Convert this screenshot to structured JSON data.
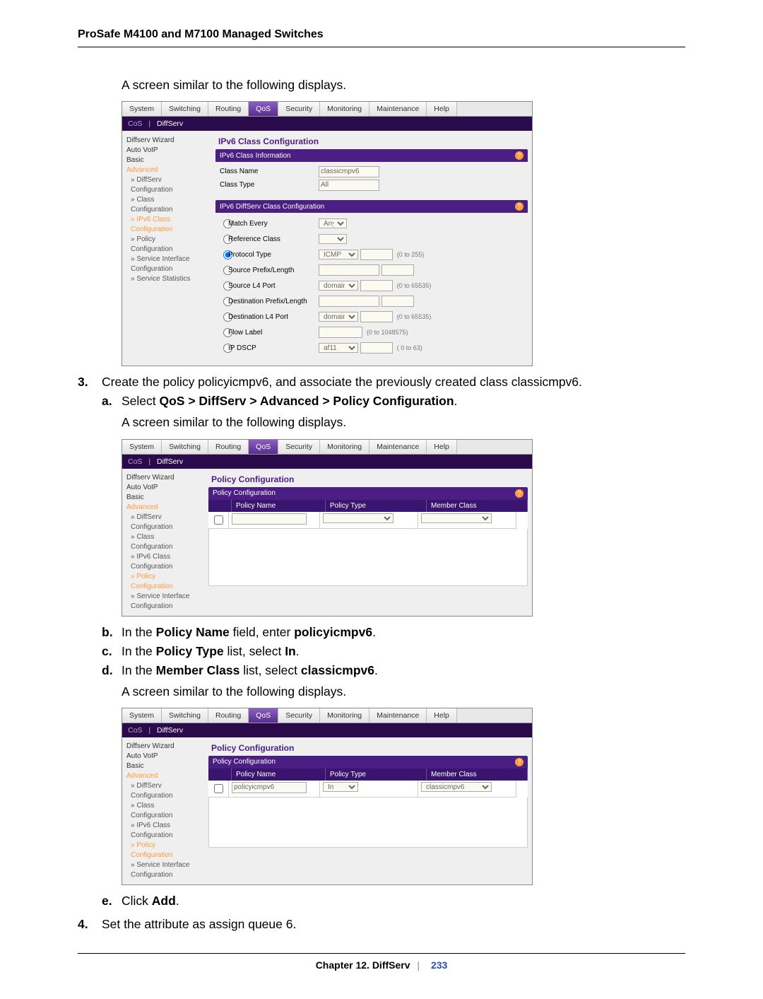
{
  "doc": {
    "header": "ProSafe M4100 and M7100 Managed Switches",
    "chapter": "Chapter 12.  DiffServ",
    "page": "233"
  },
  "text": {
    "similar1": "A screen similar to the following displays.",
    "step3": "Create the policy policyicmpv6, and associate the previously created class classicmpv6.",
    "step3a_pre": "Select ",
    "step3a_bold": "QoS > DiffServ > Advanced > Policy Configuration",
    "similar2": "A screen similar to the following displays.",
    "step3b_pre": "In the ",
    "step3b_b1": "Policy Name",
    "step3b_mid": " field, enter ",
    "step3b_b2": "policyicmpv6",
    "step3c_pre": "In the ",
    "step3c_b1": "Policy Type",
    "step3c_mid": " list, select ",
    "step3c_b2": "In",
    "step3d_pre": "In the ",
    "step3d_b1": "Member Class",
    "step3d_mid": " list, select ",
    "step3d_b2": "classicmpv6",
    "similar3": "A screen similar to the following displays.",
    "step3e_pre": "Click ",
    "step3e_b": "Add",
    "step4": "Set the attribute as assign queue 6."
  },
  "ui": {
    "tabs": [
      "System",
      "Switching",
      "Routing",
      "QoS",
      "Security",
      "Monitoring",
      "Maintenance",
      "Help"
    ],
    "subtabs": {
      "left": "CoS",
      "right": "DiffServ"
    },
    "sidebar": {
      "items": [
        "Diffserv Wizard",
        "Auto VoIP",
        "Basic",
        "Advanced",
        "DiffServ",
        "Configuration",
        "Class",
        "Configuration",
        "IPv6 Class",
        "Configuration",
        "Policy",
        "Configuration",
        "Service Interface",
        "Configuration",
        "Service Statistics"
      ]
    }
  },
  "s1": {
    "title": "IPv6 Class Configuration",
    "sub1": "IPv6 Class Information",
    "class_name_l": "Class Name",
    "class_name_v": "classicmpv6",
    "class_type_l": "Class Type",
    "class_type_v": "All",
    "sub2": "IPv6 DiffServ Class Configuration",
    "match_every": "Match Every",
    "match_every_v": "Any",
    "ref_class": "Reference Class",
    "proto_type": "Protocol Type",
    "proto_type_v": "ICMP",
    "proto_hint": "(0 to 255)",
    "src_pl": "Source Prefix/Length",
    "src_l4": "Source L4 Port",
    "src_l4_v": "domain",
    "src_l4_hint": "(0 to 65535)",
    "dst_pl": "Destination Prefix/Length",
    "dst_l4": "Destination L4 Port",
    "dst_l4_v": "domain",
    "dst_l4_hint": "(0 to 65535)",
    "flow_label": "Flow Label",
    "flow_hint": "(0 to 1048575)",
    "ip_dscp": "IP DSCP",
    "ip_dscp_v": "af11",
    "ip_dscp_hint": "( 0 to 63)"
  },
  "s2": {
    "title": "Policy Configuration",
    "sub": "Policy Configuration",
    "col_name": "Policy Name",
    "col_type": "Policy Type",
    "col_member": "Member Class"
  },
  "s3": {
    "title": "Policy Configuration",
    "sub": "Policy Configuration",
    "col_name": "Policy Name",
    "col_type": "Policy Type",
    "col_member": "Member Class",
    "val_name": "policyicmpv6",
    "val_type": "In",
    "val_member": "classicmpv6"
  }
}
